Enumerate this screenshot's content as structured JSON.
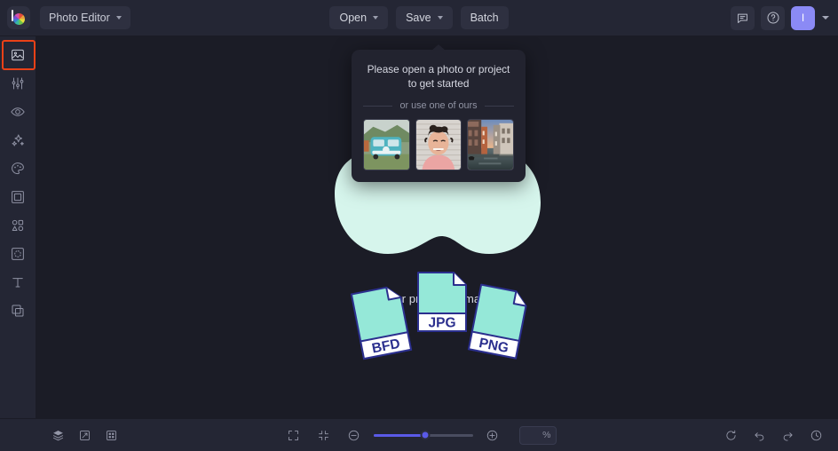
{
  "app": {
    "name": "BeFunky Photo Editor",
    "background_color": "#1b1c26",
    "panel_color": "#242634",
    "accent_color": "#5a5ae8",
    "selection_color": "#ea4117"
  },
  "header": {
    "logo_name": "befunky-logo",
    "mode_selector": {
      "label": "Photo Editor",
      "icon": "chevron-down-icon"
    },
    "center_buttons": [
      {
        "label": "Open",
        "name": "open-button",
        "has_chevron": true
      },
      {
        "label": "Save",
        "name": "save-button",
        "has_chevron": true
      },
      {
        "label": "Batch",
        "name": "batch-button",
        "has_chevron": false
      }
    ],
    "right_icons": [
      {
        "name": "feedback-icon",
        "title": "Feedback"
      },
      {
        "name": "help-icon",
        "title": "Help"
      }
    ],
    "avatar": {
      "initial": "I",
      "color": "#8b8af5",
      "name": "user-avatar"
    }
  },
  "sidebar": {
    "items": [
      {
        "name": "sidebar-item-edit",
        "icon": "image-icon",
        "label": "Edit",
        "selected": true
      },
      {
        "name": "sidebar-item-touchup",
        "icon": "sliders-icon",
        "label": "Touch Up",
        "selected": false
      },
      {
        "name": "sidebar-item-retouch",
        "icon": "eye-icon",
        "label": "Retouch",
        "selected": false
      },
      {
        "name": "sidebar-item-effects",
        "icon": "sparkle-icon",
        "label": "Effects",
        "selected": false
      },
      {
        "name": "sidebar-item-artsy",
        "icon": "palette-icon",
        "label": "Artsy",
        "selected": false
      },
      {
        "name": "sidebar-item-frames",
        "icon": "frame-icon",
        "label": "Frames",
        "selected": false
      },
      {
        "name": "sidebar-item-graphics",
        "icon": "shapes-icon",
        "label": "Graphics",
        "selected": false
      },
      {
        "name": "sidebar-item-textures",
        "icon": "texture-icon",
        "label": "Textures",
        "selected": false
      },
      {
        "name": "sidebar-item-text",
        "icon": "text-icon",
        "label": "Text",
        "selected": false
      },
      {
        "name": "sidebar-item-overlays",
        "icon": "layers-alt-icon",
        "label": "Overlays",
        "selected": false
      }
    ]
  },
  "popup": {
    "title": "Please open a photo or project to get started",
    "divider_label": "or use one of ours",
    "samples": [
      {
        "name": "sample-thumbnail-van",
        "alt": "Teal VW camper van on grass"
      },
      {
        "name": "sample-thumbnail-portrait",
        "alt": "Smiling woman portrait"
      },
      {
        "name": "sample-thumbnail-canal",
        "alt": "Venice canal at sunset"
      }
    ]
  },
  "dropzone": {
    "message": "Drop your project or image here",
    "blob_color": "#d6f5ec",
    "file_fill": "#95e8d8",
    "file_stroke": "#2b2f8e",
    "files": [
      {
        "label": "BFD",
        "name": "file-icon-bfd"
      },
      {
        "label": "JPG",
        "name": "file-icon-jpg"
      },
      {
        "label": "PNG",
        "name": "file-icon-png"
      }
    ]
  },
  "footer": {
    "left_icons": [
      {
        "name": "layers-button",
        "icon": "layers-icon"
      },
      {
        "name": "resize-button",
        "icon": "resize-icon"
      },
      {
        "name": "grid-button",
        "icon": "grid-icon"
      }
    ],
    "view_icons": [
      {
        "name": "fit-to-screen-button",
        "icon": "expand-corners-icon"
      },
      {
        "name": "actual-size-button",
        "icon": "collapse-corners-icon"
      }
    ],
    "zoom": {
      "out_label": "−",
      "in_label": "+",
      "slider_value": 52,
      "input_value": "",
      "unit": "%",
      "placeholder": ""
    },
    "right_icons": [
      {
        "name": "reset-button",
        "icon": "reset-icon"
      },
      {
        "name": "undo-button",
        "icon": "undo-icon"
      },
      {
        "name": "redo-button",
        "icon": "redo-icon"
      },
      {
        "name": "history-button",
        "icon": "history-icon"
      }
    ]
  }
}
